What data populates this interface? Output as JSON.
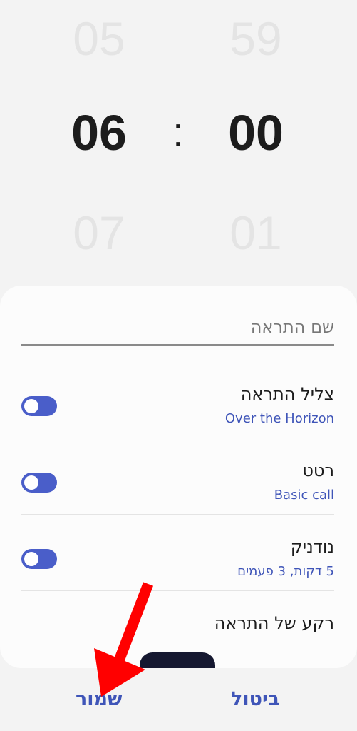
{
  "time_picker": {
    "hours": {
      "prev": "05",
      "current": "06",
      "next": "07"
    },
    "separator": ":",
    "minutes": {
      "prev": "59",
      "current": "00",
      "next": "01"
    }
  },
  "alarm_name": {
    "placeholder": "שם התראה",
    "value": ""
  },
  "settings": [
    {
      "title": "צליל התראה",
      "subtitle": "Over the Horizon",
      "enabled": true
    },
    {
      "title": "רטט",
      "subtitle": "Basic call",
      "enabled": true
    },
    {
      "title": "נודניק",
      "subtitle": "5 דקות, 3 פעמים",
      "enabled": true
    }
  ],
  "background": {
    "title": "רקע של התראה"
  },
  "actions": {
    "save_label": "שמור",
    "cancel_label": "ביטול"
  },
  "colors": {
    "accent": "#4a5ec9",
    "link": "#3f55b8",
    "annotation_arrow": "#ff0000"
  }
}
